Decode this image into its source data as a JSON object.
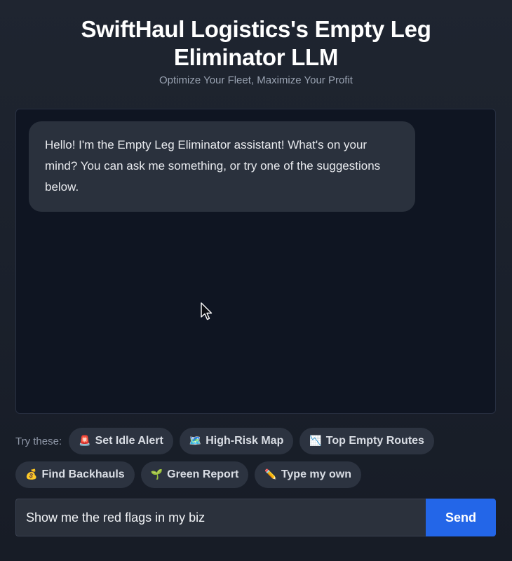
{
  "header": {
    "title": "SwiftHaul Logistics's Empty Leg Eliminator LLM",
    "subtitle": "Optimize Your Fleet, Maximize Your Profit"
  },
  "chat": {
    "messages": [
      {
        "role": "assistant",
        "text": "Hello! I'm the Empty Leg Eliminator assistant! What's on your mind? You can ask me something, or try one of the suggestions below."
      }
    ]
  },
  "suggestions": {
    "label": "Try these:",
    "chips": [
      {
        "emoji": "🚨",
        "icon": "siren-icon",
        "label": "Set Idle Alert"
      },
      {
        "emoji": "🗺️",
        "icon": "map-icon",
        "label": "High-Risk Map"
      },
      {
        "emoji": "📉",
        "icon": "chart-down-icon",
        "label": "Top Empty Routes"
      },
      {
        "emoji": "💰",
        "icon": "money-bag-icon",
        "label": "Find Backhauls"
      },
      {
        "emoji": "🌱",
        "icon": "seedling-icon",
        "label": "Green Report"
      },
      {
        "emoji": "✏️",
        "icon": "pencil-icon",
        "label": "Type my own"
      }
    ]
  },
  "composer": {
    "value": "Show me the red flags in my biz",
    "send_label": "Send",
    "send_color": "#2366e8"
  }
}
